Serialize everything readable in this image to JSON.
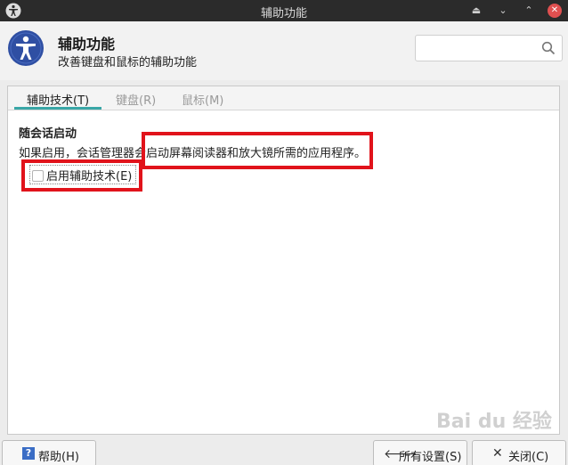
{
  "window": {
    "title": "辅助功能",
    "controls": [
      "minimize-icon",
      "restore-icon",
      "maximize-icon",
      "close-icon"
    ]
  },
  "header": {
    "title": "辅助功能",
    "subtitle": "改善键盘和鼠标的辅助功能",
    "icon": "accessibility-icon",
    "search": {
      "value": "",
      "placeholder": ""
    }
  },
  "tabs": [
    {
      "label": "辅助技术(T)",
      "active": true
    },
    {
      "label": "键盘(R)",
      "active": false
    },
    {
      "label": "鼠标(M)",
      "active": false
    }
  ],
  "section": {
    "title": "随会话启动",
    "description": "如果启用，会话管理器会启动屏幕阅读器和放大镜所需的应用程序。",
    "checkbox_label": "启用辅助技术(E)",
    "checkbox_checked": false
  },
  "buttons": {
    "help": "帮助(H)",
    "all_settings": "所有设置(S)",
    "close": "关闭(C)"
  },
  "colors": {
    "accent": "#39a7a7",
    "highlight": "#e1131b",
    "titlebar": "#2b2b2b",
    "icon_bg": "#2f4fa3"
  },
  "watermark": "Bai du 经验"
}
